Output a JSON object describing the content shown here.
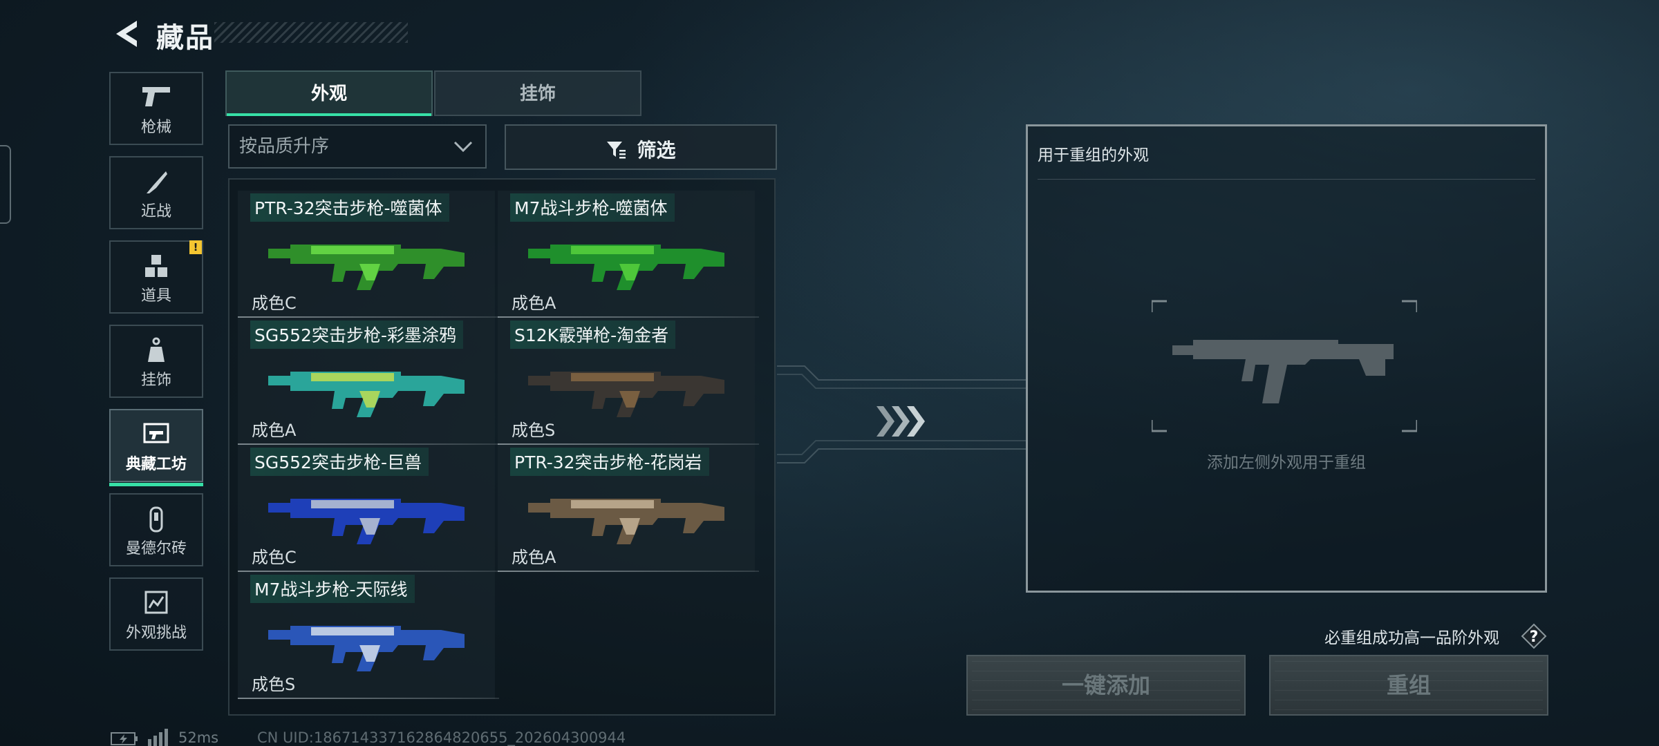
{
  "header": {
    "title": "藏品"
  },
  "sidebar": {
    "items": [
      {
        "label": "枪械",
        "icon": "pistol-icon"
      },
      {
        "label": "近战",
        "icon": "knife-icon"
      },
      {
        "label": "道具",
        "icon": "cubes-icon",
        "badge": "!"
      },
      {
        "label": "挂饰",
        "icon": "charm-icon"
      },
      {
        "label": "典藏工坊",
        "icon": "workshop-icon",
        "active": true
      },
      {
        "label": "曼德尔砖",
        "icon": "brick-icon"
      },
      {
        "label": "外观挑战",
        "icon": "challenge-icon"
      }
    ]
  },
  "tabs": [
    {
      "label": "外观",
      "active": true
    },
    {
      "label": "挂饰",
      "active": false
    }
  ],
  "sort": {
    "label": "按品质升序"
  },
  "filter": {
    "label": "筛选"
  },
  "items": [
    {
      "name": "PTR-32突击步枪-噬菌体",
      "grade": "成色C",
      "colors": [
        "#2f8f2a",
        "#6fe24a"
      ]
    },
    {
      "name": "M7战斗步枪-噬菌体",
      "grade": "成色A",
      "colors": [
        "#1f8f2c",
        "#5ad43f"
      ]
    },
    {
      "name": "SG552突击步枪-彩墨涂鸦",
      "grade": "成色A",
      "colors": [
        "#2aa59a",
        "#c9e14e"
      ]
    },
    {
      "name": "S12K霰弹枪-淘金者",
      "grade": "成色S",
      "colors": [
        "#3a3632",
        "#8a6a44"
      ]
    },
    {
      "name": "SG552突击步枪-巨兽",
      "grade": "成色C",
      "colors": [
        "#1e3fb8",
        "#c7cfd6"
      ]
    },
    {
      "name": "PTR-32突击步枪-花岗岩",
      "grade": "成色A",
      "colors": [
        "#6b5a44",
        "#c9b79b"
      ]
    },
    {
      "name": "M7战斗步枪-天际线",
      "grade": "成色S",
      "colors": [
        "#2a56b8",
        "#dfe6ee"
      ]
    }
  ],
  "reorg": {
    "title": "用于重组的外观",
    "hint": "添加左侧外观用于重组",
    "guarantee": "必重组成功高一品阶外观",
    "help": "?"
  },
  "buttons": {
    "add_all": "一键添加",
    "reorg": "重组"
  },
  "status": {
    "ping": "52ms",
    "uid": "CN UID:1867143371628648206​55_202604300944"
  },
  "colors": {
    "accent": "#37e0a6",
    "badge": "#f4c531"
  }
}
